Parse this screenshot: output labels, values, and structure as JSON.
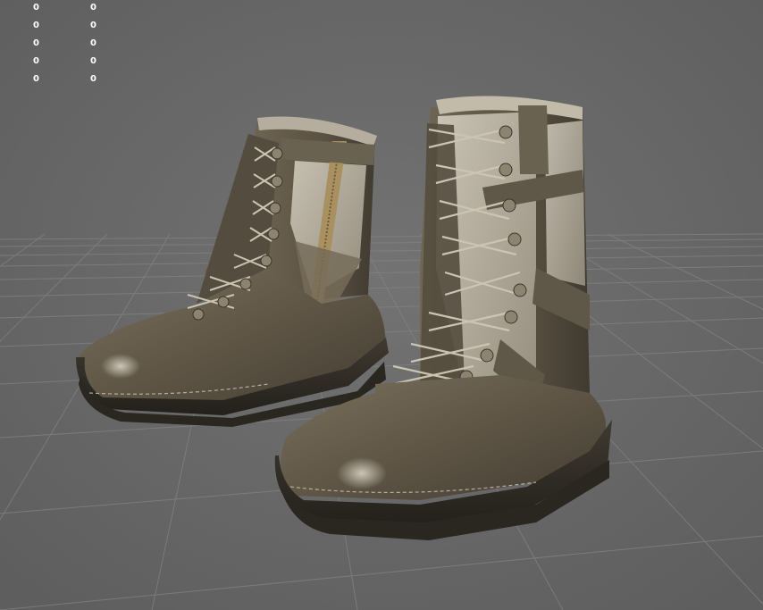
{
  "stats_overlay": {
    "rows": [
      {
        "left": "0",
        "right": "0"
      },
      {
        "left": "0",
        "right": "0"
      },
      {
        "left": "0",
        "right": "0"
      },
      {
        "left": "0",
        "right": "0"
      },
      {
        "left": "0",
        "right": "0"
      }
    ]
  },
  "colors": {
    "background": "#6b6b6b",
    "grid_line": "#7d7d7d",
    "boot_leather": "#5f5646",
    "boot_fabric": "#bdb6a6",
    "sole": "#2f2c26",
    "zipper": "#a89060"
  },
  "scene": {
    "subject": "pair-of-tactical-boots",
    "ground": "perspective-grid"
  }
}
